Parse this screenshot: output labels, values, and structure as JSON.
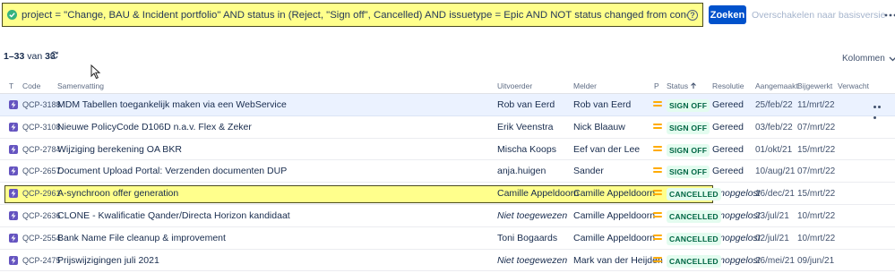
{
  "query": {
    "text": "project = \"Change, BAU & Incident portfolio\" AND status in (Reject, \"Sign off\", Cancelled) AND issuetype = Epic AND NOT status changed from concept to cancelled  ORDER BY status ASC",
    "valid_icon": "check-circle-icon",
    "help_icon": "question-circle-icon",
    "help_glyph": "?"
  },
  "search": {
    "button_label": "Zoeken",
    "basic_link": "Overschakelen naar basisversie"
  },
  "results": {
    "range": "1–33",
    "of_label": "van",
    "total": "33"
  },
  "columns_button": "Kolommen",
  "colors": {
    "accent": "#0052cc",
    "highlight": "#ffff8c",
    "epic": "#6554c0",
    "priority_medium": "#ffab00"
  },
  "headers": {
    "type": "T",
    "key": "Code",
    "summary": "Samenvatting",
    "assignee": "Uitvoerder",
    "reporter": "Melder",
    "priority": "P",
    "status": "Status",
    "resolution": "Resolutie",
    "created": "Aangemaakt",
    "updated": "Bijgewerkt",
    "due": "Verwacht"
  },
  "rows": [
    {
      "key": "QCP-3188",
      "summary": "MDM Tabellen toegankelijk maken via een WebService",
      "assignee": "Rob van Eerd",
      "reporter": "Rob van Eerd",
      "status": "SIGN OFF",
      "resolution": "Gereed",
      "created": "25/feb/22",
      "updated": "11/mrt/22",
      "due": ""
    },
    {
      "key": "QCP-3108",
      "summary": "Nieuwe PolicyCode D106D n.a.v. Flex & Zeker",
      "assignee": "Erik Veenstra",
      "reporter": "Nick Blaauw",
      "status": "SIGN OFF",
      "resolution": "Gereed",
      "created": "03/feb/22",
      "updated": "07/mrt/22",
      "due": ""
    },
    {
      "key": "QCP-2784",
      "summary": "Wijziging berekening OA BKR",
      "assignee": "Mischa Koops",
      "reporter": "Eef van der Lee",
      "status": "SIGN OFF",
      "resolution": "Gereed",
      "created": "01/okt/21",
      "updated": "15/mrt/22",
      "due": ""
    },
    {
      "key": "QCP-2657",
      "summary": "Document Upload Portal: Verzenden documenten DUP",
      "assignee": "anja.huigen",
      "reporter": "Sander",
      "status": "SIGN OFF",
      "resolution": "Gereed",
      "created": "10/aug/21",
      "updated": "07/mrt/22",
      "due": ""
    },
    {
      "key": "QCP-2961",
      "summary": "A-synchroon offer generation",
      "assignee": "Camille Appeldoorn",
      "reporter": "Camille Appeldoorn",
      "status": "CANCELLED",
      "resolution": "Onopgelost",
      "created": "16/dec/21",
      "updated": "15/mrt/22",
      "due": ""
    },
    {
      "key": "QCP-2636",
      "summary": "CLONE - Kwalificatie Qander/Directa Horizon kandidaat",
      "assignee": "Niet toegewezen",
      "reporter": "Camille Appeldoorn",
      "status": "CANCELLED",
      "resolution": "Onopgelost",
      "created": "23/jul/21",
      "updated": "10/mrt/22",
      "due": ""
    },
    {
      "key": "QCP-2554",
      "summary": "Bank Name File cleanup & improvement",
      "assignee": "Toni Bogaards",
      "reporter": "Camille Appeldoorn",
      "status": "CANCELLED",
      "resolution": "Onopgelost",
      "created": "02/jul/21",
      "updated": "10/mrt/22",
      "due": ""
    },
    {
      "key": "QCP-2475",
      "summary": "Prijswijzigingen juli 2021",
      "assignee": "Niet toegewezen",
      "reporter": "Mark van der Heijden",
      "status": "CANCELLED",
      "resolution": "Onopgelost",
      "created": "26/mei/21",
      "updated": "09/jun/21",
      "due": ""
    }
  ]
}
